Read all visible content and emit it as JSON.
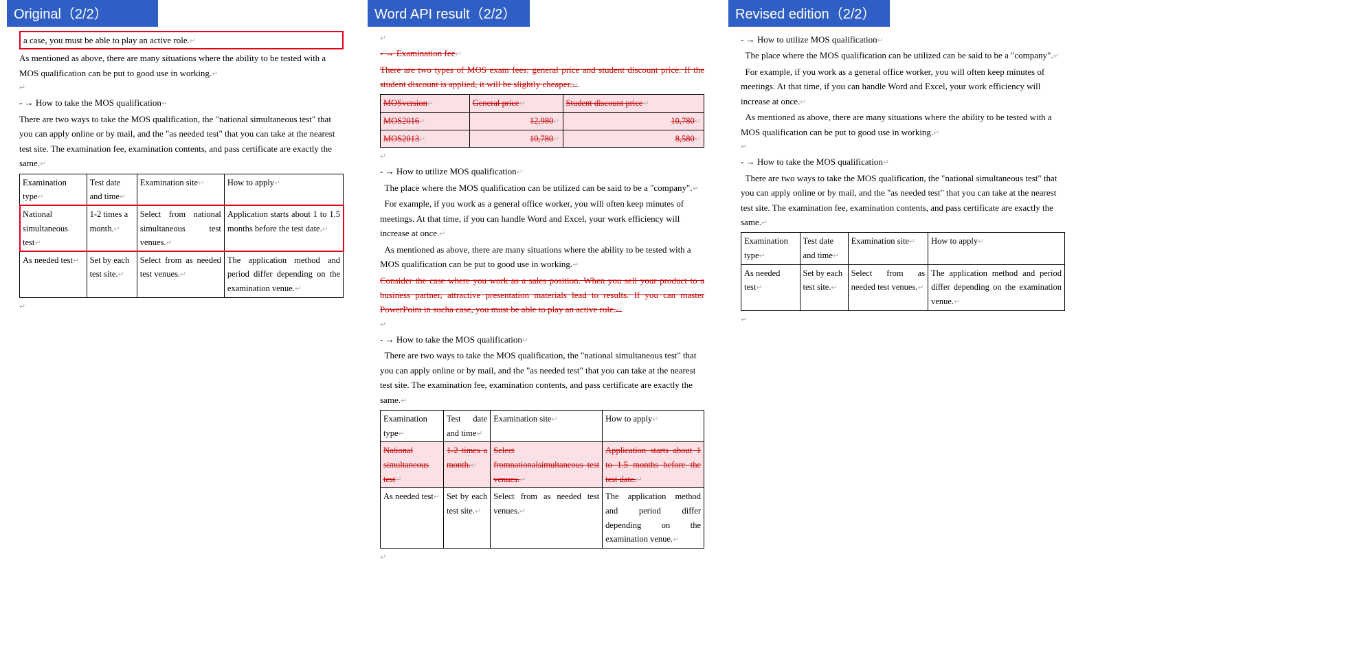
{
  "tabs": {
    "original": "Original（2/2）",
    "api": "Word API result（2/2）",
    "revised": "Revised edition（2/2）"
  },
  "para_mark": "↵",
  "orig": {
    "frag": "a case, you must be able to play an active role.",
    "mentioned": "As mentioned as above, there are many situations where the ability to be tested with a MOS qualification can be put to good use in working.",
    "dash": "- ",
    "take_h": "→ How to take the MOS qualification",
    "take_p": "There are two ways to take the MOS qualification, the \"national simultaneous test\" that you can apply online or by mail, and the \"as needed test\" that you can take at the nearest test site. The examination fee, examination contents, and pass certificate are exactly the same.",
    "t1": {
      "h": [
        "Examination type",
        "Test date and time",
        "Examination site",
        "How to apply"
      ],
      "r1": [
        "National simultaneous test",
        "1-2 times a month.",
        "Select from national simultaneous test venues.",
        "Application starts about 1 to 1.5 months before the test date."
      ],
      "r2": [
        "As needed test",
        "Set by each test site.",
        "Select from as needed test venues.",
        "The application method and period differ depending on the examination venue."
      ]
    }
  },
  "api": {
    "fee_h": "→ Examination fee",
    "fee_p": "There are two types of MOS exam fees: general price and student discount price. If the student discount is applied, it will be slightly cheaper.",
    "feetab": {
      "h": [
        "MOSversion",
        "General price",
        "Student discount price"
      ],
      "r1": [
        "MOS2016",
        "12,980",
        "10,780"
      ],
      "r2": [
        "MOS2013",
        "10,780",
        "8,580"
      ]
    },
    "util_h": "→ How to utilize MOS qualification",
    "util_p1": "The place where the MOS qualification can be utilized can be said to be a \"company\".",
    "util_p2": "For example, if you work as a general office worker, you will often keep minutes of meetings. At that time, if you can handle Word and Excel, your work efficiency will increase at once.",
    "util_p3": "As mentioned as above, there are many situations where the ability to be tested with a MOS qualification can be put to good use in working.",
    "util_del": "Consider the case where you work as a sales position. When you sell your product to a business partner, attractive presentation materials lead to results. If you can master PowerPoint in sucha case, you must be able to play an active role.",
    "take_h": "→ How to take the MOS qualification",
    "take_p": "There are two ways to take the MOS qualification, the \"national simultaneous test\" that you can apply online or by mail, and the \"as needed test\" that you can take at the nearest test site. The examination fee, examination contents, and pass certificate are exactly the same.",
    "t2": {
      "h": [
        "Examination type",
        "Test date and time",
        "Examination site",
        "How to apply"
      ],
      "r1": [
        "National simultaneous test",
        "1-2 times a month.",
        "Select fromnationalsimultaneous test venues.",
        "Application starts about 1 to 1.5 months before the test date."
      ],
      "r2": [
        "As needed test",
        "Set by each test site.",
        "Select from as needed test venues.",
        "The application method and period differ depending on the examination venue."
      ]
    }
  },
  "rev": {
    "util_h": "→ How to utilize MOS qualification",
    "util_p1": "The place where the MOS qualification can be utilized can be said to be a \"company\".",
    "util_p2": "For example, if you work as a general office worker, you will often keep minutes of meetings. At that time, if you can handle Word and Excel, your work efficiency will increase at once.",
    "util_p3": "As mentioned as above, there are many situations where the ability to be tested with a MOS qualification can be put to good use in working.",
    "take_h": "→ How to take the MOS qualification",
    "take_p": "There are two ways to take the MOS qualification, the \"national simultaneous test\" that you can apply online or by mail, and the \"as needed test\" that you can take at the nearest test site. The examination fee, examination contents, and pass certificate are exactly the same.",
    "t3": {
      "h": [
        "Examination type",
        "Test date and time",
        "Examination site",
        "How to apply"
      ],
      "r2": [
        "As needed test",
        "Set by each test site.",
        "Select from as needed test venues.",
        "The application method and period differ depending on the examination venue."
      ]
    }
  }
}
